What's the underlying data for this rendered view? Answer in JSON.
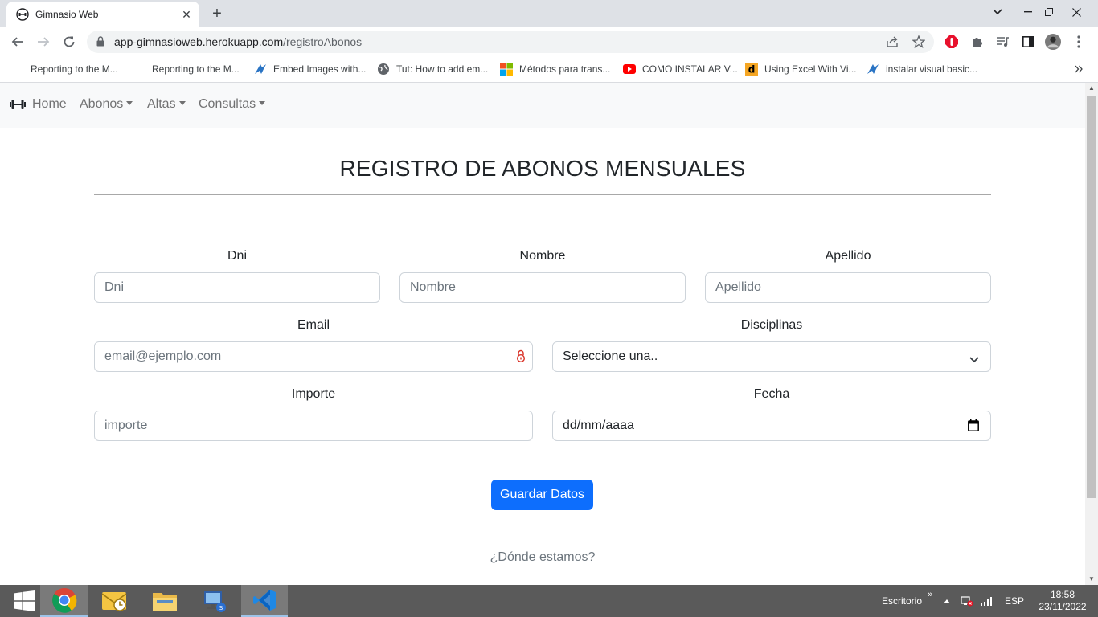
{
  "browser": {
    "tab_title": "Gimnasio Web",
    "url_host": "app-gimnasioweb.herokuapp.com",
    "url_path": "/registroAbonos",
    "bookmarks": [
      {
        "label": "Reporting to the M...",
        "icon": "none"
      },
      {
        "label": "Reporting to the M...",
        "icon": "none"
      },
      {
        "label": "Embed Images with...",
        "icon": "blue-shape-icon"
      },
      {
        "label": "Tut: How to add em...",
        "icon": "globe-icon"
      },
      {
        "label": "Métodos para trans...",
        "icon": "microsoft-icon"
      },
      {
        "label": "COMO INSTALAR V...",
        "icon": "youtube-icon"
      },
      {
        "label": "Using Excel With Vi...",
        "icon": "d-icon"
      },
      {
        "label": "instalar visual basic...",
        "icon": "blue-shape-icon"
      }
    ]
  },
  "navbar": {
    "brand": "Home",
    "menus": [
      "Abonos",
      "Altas",
      "Consultas"
    ]
  },
  "form": {
    "heading": "REGISTRO DE ABONOS MENSUALES",
    "dni_label": "Dni",
    "dni_placeholder": "Dni",
    "nombre_label": "Nombre",
    "nombre_placeholder": "Nombre",
    "apellido_label": "Apellido",
    "apellido_placeholder": "Apellido",
    "email_label": "Email",
    "email_placeholder": "email@ejemplo.com",
    "disciplinas_label": "Disciplinas",
    "disciplinas_value": "Seleccione una..",
    "importe_label": "Importe",
    "importe_placeholder": "importe",
    "fecha_label": "Fecha",
    "fecha_value": "dd/mm/aaaa",
    "submit_label": "Guardar Datos",
    "footer_link": "¿Dónde estamos?"
  },
  "taskbar": {
    "desktop_label": "Escritorio",
    "language": "ESP",
    "time": "18:58",
    "date": "23/11/2022"
  },
  "colors": {
    "primary": "#0d6efd",
    "navbar_bg": "#f8f9fa",
    "taskbar_bg": "#5a5a5a"
  }
}
